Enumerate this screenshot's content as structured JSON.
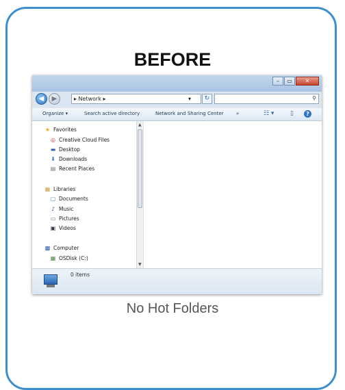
{
  "heading": "BEFORE",
  "caption": "No Hot Folders",
  "colors": {
    "card_border": "#3b8fd0",
    "window_frame": "#dbe6f1"
  },
  "window": {
    "controls": {
      "minimize": "–",
      "maximize": "▭",
      "close": "✕"
    },
    "nav": {
      "back_icon": "◀",
      "forward_icon": "▶"
    },
    "address": {
      "path": "▸ Network ▸",
      "dropdown_icon": "▾",
      "refresh_icon": "↻"
    },
    "search": {
      "placeholder": "",
      "icon": "⚲"
    },
    "toolbar": {
      "organize": "Organize ▾",
      "search_ad": "Search active directory",
      "network_center": "Network and Sharing Center",
      "more": "»",
      "views_icon": "☷ ▾",
      "preview_icon": "▯",
      "help_icon": "?"
    },
    "nav_groups": [
      {
        "label": "Favorites",
        "icon": "★",
        "items": [
          {
            "label": "Creative Cloud Files",
            "icon": "◎"
          },
          {
            "label": "Desktop",
            "icon": "▬"
          },
          {
            "label": "Downloads",
            "icon": "⬇"
          },
          {
            "label": "Recent Places",
            "icon": "▤"
          }
        ]
      },
      {
        "label": "Libraries",
        "icon": "▦",
        "items": [
          {
            "label": "Documents",
            "icon": "▢"
          },
          {
            "label": "Music",
            "icon": "♪"
          },
          {
            "label": "Pictures",
            "icon": "▭"
          },
          {
            "label": "Videos",
            "icon": "▣"
          }
        ]
      },
      {
        "label": "Computer",
        "icon": "▩",
        "items": [
          {
            "label": "OSDisk (C:)",
            "icon": "▦"
          }
        ]
      }
    ],
    "status": {
      "item_count": "0 items"
    }
  }
}
